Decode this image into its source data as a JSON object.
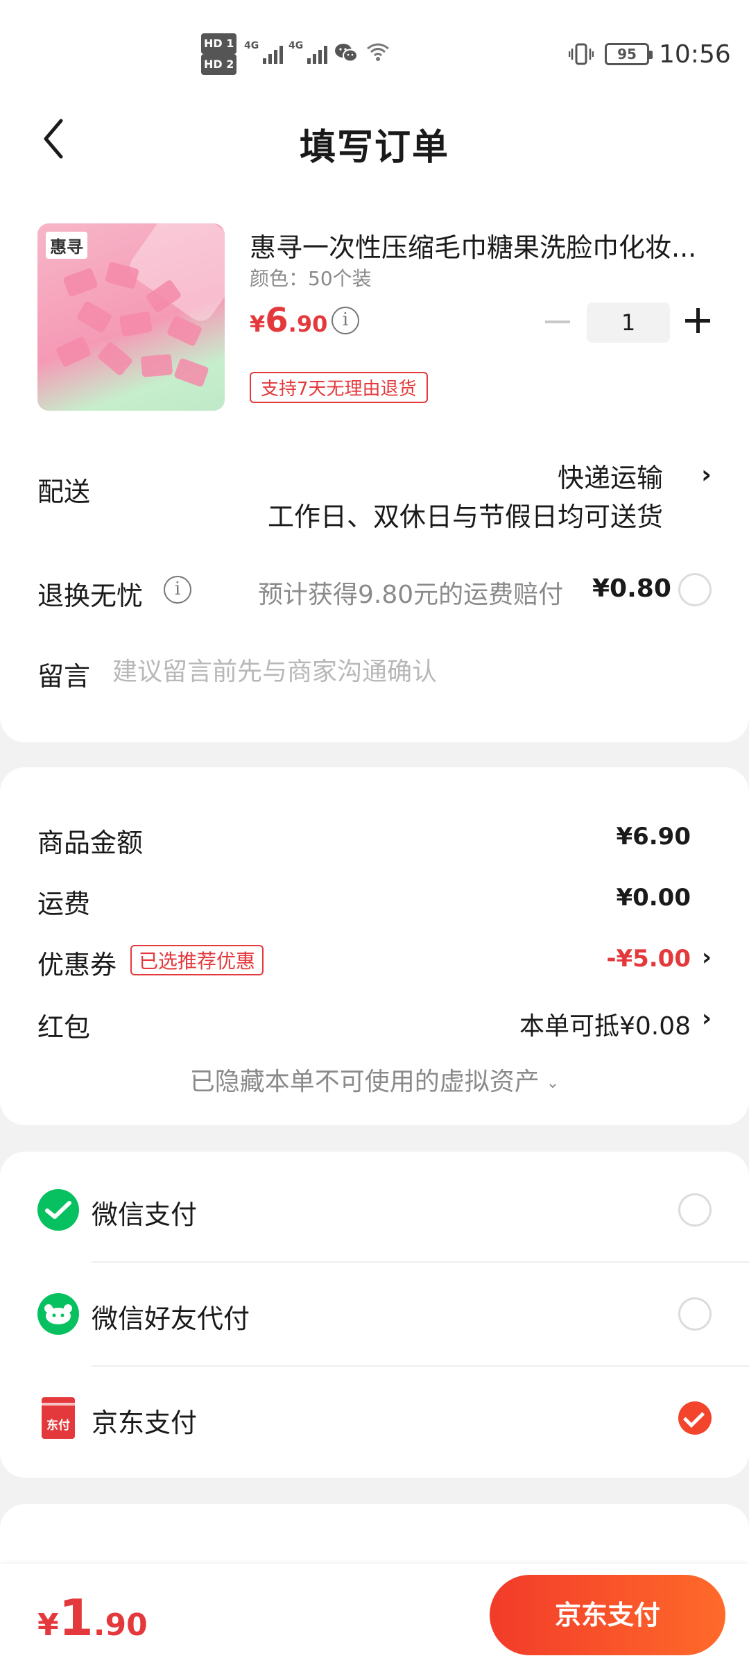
{
  "status_bar": {
    "sim1": "HD 1",
    "sim2": "HD 2",
    "network1": "4G",
    "network2": "4G",
    "battery": "95",
    "time": "10:56"
  },
  "header": {
    "title": "填写订单"
  },
  "product": {
    "logo_text": "惠寻",
    "title": "惠寻一次性压缩毛巾糖果洗脸巾化妆...",
    "spec": "颜色：50个装",
    "price_currency": "¥",
    "price_int": "6",
    "price_dec": ".90",
    "quantity": "1",
    "return_tag": "支持7天无理由退货"
  },
  "delivery": {
    "label": "配送",
    "method": "快递运输",
    "note": "工作日、双休日与节假日均可送货"
  },
  "return_worry": {
    "label": "退换无忧",
    "desc": "预计获得9.80元的运费赔付",
    "price": "¥0.80"
  },
  "message": {
    "label": "留言",
    "placeholder": "建议留言前先与商家沟通确认"
  },
  "summary": {
    "goods_label": "商品金额",
    "goods_value": "¥6.90",
    "shipping_label": "运费",
    "shipping_value": "¥0.00",
    "coupon_label": "优惠券",
    "coupon_tag": "已选推荐优惠",
    "coupon_value": "-¥5.00",
    "redpacket_label": "红包",
    "redpacket_value": "本单可抵¥0.08",
    "hidden_assets": "已隐藏本单不可使用的虚拟资产"
  },
  "payment": {
    "options": [
      {
        "label": "微信支付",
        "icon": "wechat-pay-icon",
        "selected": false
      },
      {
        "label": "微信好友代付",
        "icon": "wechat-friend-pay-icon",
        "selected": false
      },
      {
        "label": "京东支付",
        "icon": "jd-pay-icon",
        "selected": true
      }
    ],
    "jd_icon_text": "东付"
  },
  "bottom": {
    "total_currency": "¥",
    "total_int": "1",
    "total_dec": ".90",
    "submit_label": "京东支付"
  },
  "colors": {
    "accent_red": "#e4393c",
    "wechat_green": "#07c160",
    "checked_orange": "#f2452b"
  }
}
